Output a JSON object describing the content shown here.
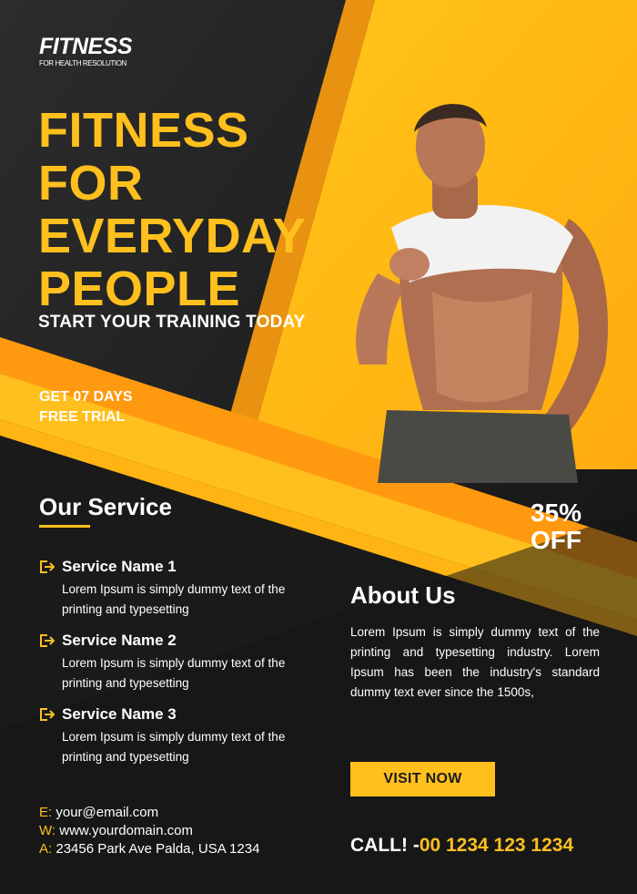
{
  "logo": {
    "main": "FITNESS",
    "sub": "FOR HEALTH RESOLUTION"
  },
  "headline": [
    "FITNESS",
    "FOR",
    "EVERYDAY",
    "PEOPLE"
  ],
  "tagline": "START YOUR TRAINING TODAY",
  "trial": [
    "GET 07 DAYS",
    "FREE TRIAL"
  ],
  "discount": [
    "35%",
    "OFF"
  ],
  "services": {
    "title": "Our Service",
    "items": [
      {
        "name": "Service Name 1",
        "desc": "Lorem Ipsum is simply dummy text of the printing and typesetting"
      },
      {
        "name": "Service Name 2",
        "desc": "Lorem Ipsum is simply dummy text of the printing and typesetting"
      },
      {
        "name": "Service Name 3",
        "desc": "Lorem Ipsum is simply dummy text of the printing and typesetting"
      }
    ]
  },
  "about": {
    "title": "About Us",
    "text": "Lorem Ipsum is simply dummy text of the printing and typesetting industry. Lorem Ipsum has been the industry's standard dummy text ever since the 1500s,"
  },
  "cta": "VISIT NOW",
  "contact": {
    "email_label": "E:",
    "email": "your@email.com",
    "web_label": "W:",
    "web": "www.yourdomain.com",
    "address_label": "A:",
    "address": "23456 Park Ave Palda, USA 1234"
  },
  "call": {
    "label": "CALL! -",
    "number": "00 1234 123 1234"
  },
  "colors": {
    "accent": "#ffc01e",
    "orange": "#ff9a10",
    "dark": "#1b1b1b"
  },
  "icons": {
    "service": "arrow-right-bracket-icon"
  }
}
